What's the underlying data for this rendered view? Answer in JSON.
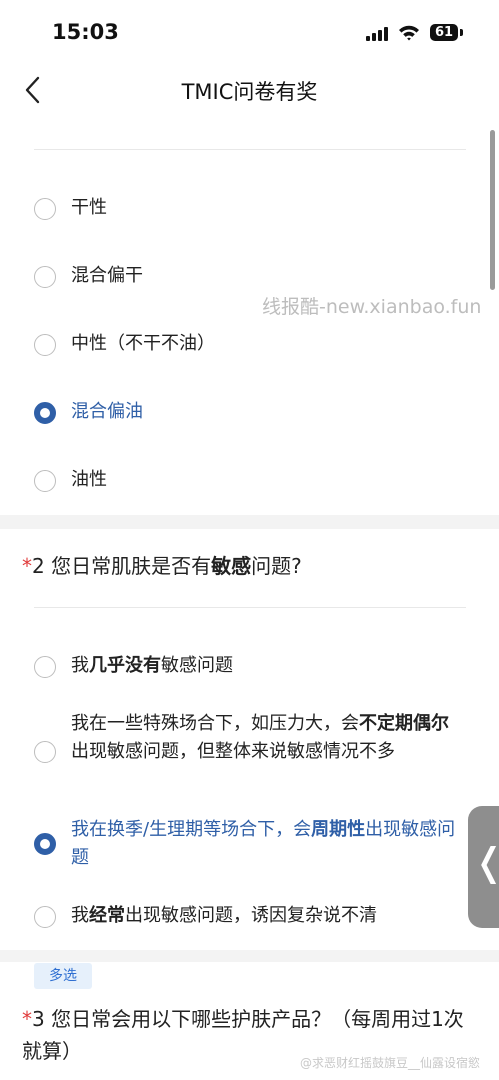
{
  "status": {
    "time": "15:03",
    "battery": "61"
  },
  "nav": {
    "title": "TMIC问卷有奖"
  },
  "q1": {
    "options": [
      {
        "label": "干性",
        "selected": false
      },
      {
        "label": "混合偏干",
        "selected": false
      },
      {
        "label": "中性（不干不油）",
        "selected": false
      },
      {
        "label": "混合偏油",
        "selected": true
      },
      {
        "label": "油性",
        "selected": false
      }
    ]
  },
  "q2": {
    "required_mark": "*",
    "title_before": "2 您日常肌肤是否有",
    "title_bold": "敏感",
    "title_after": "问题?",
    "options": [
      {
        "parts": [
          "我",
          "几乎没有",
          "敏感问题"
        ],
        "selected": false
      },
      {
        "parts": [
          "我在一些特殊场合下，如压力大，会",
          "不定期偶尔",
          "出现敏感问题，但整体来说敏感情况不多"
        ],
        "selected": false
      },
      {
        "parts": [
          "我在换季/生理期等场合下，会",
          "周期性",
          "出现敏感问题"
        ],
        "selected": true
      },
      {
        "parts": [
          "我",
          "经常",
          "出现敏感问题，诱因复杂说不清"
        ],
        "selected": false
      }
    ]
  },
  "q3": {
    "badge": "多选",
    "required_mark": "*",
    "title": "3 您日常会用以下哪些护肤产品？（每周用过1次就算）"
  },
  "watermark": "线报酷-new.xianbao.fun",
  "bottom_watermark": "@求恶财红摇鼓旗豆__仙露设宿慾",
  "float_tab_icon": "❬",
  "colors": {
    "accent": "#2f5fa7",
    "required": "#e03b3b",
    "badge_bg": "#e6f0fb",
    "badge_text": "#2f6fd1"
  }
}
